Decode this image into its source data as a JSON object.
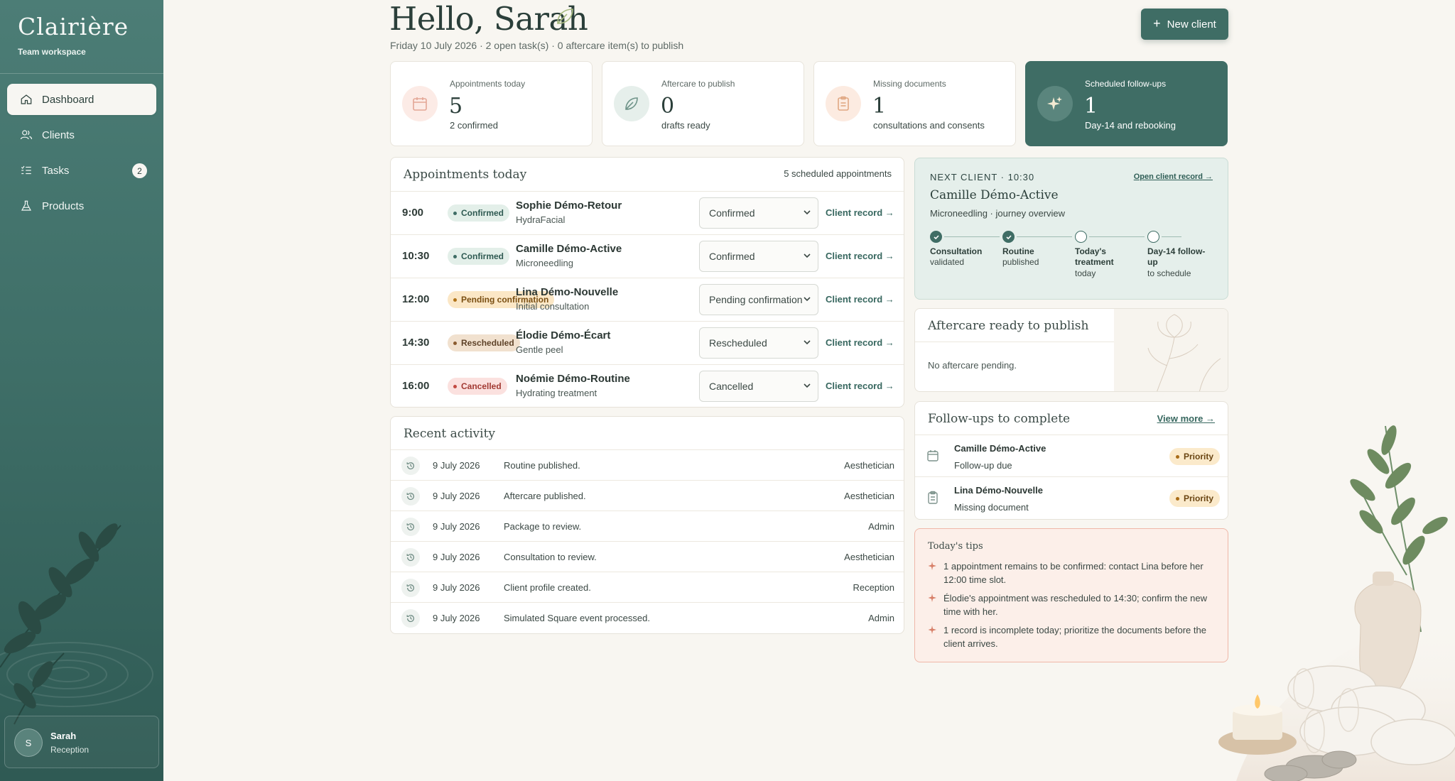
{
  "app": {
    "brand": "Clairière",
    "workspace": "Team workspace"
  },
  "sidebar": {
    "items": [
      {
        "label": "Dashboard",
        "icon": "home-icon",
        "active": true
      },
      {
        "label": "Clients",
        "icon": "users-icon"
      },
      {
        "label": "Tasks",
        "icon": "checklist-icon",
        "badge": "2"
      },
      {
        "label": "Products",
        "icon": "flask-icon"
      }
    ]
  },
  "user": {
    "initial": "S",
    "name": "Sarah",
    "role": "Reception"
  },
  "header": {
    "greeting": "Hello, Sarah",
    "subtitle": "Friday 10 July 2026 · 2 open task(s) · 0 aftercare item(s) to publish",
    "new_client_label": "New client"
  },
  "stats": [
    {
      "label": "Appointments today",
      "value": "5",
      "note": "2 confirmed",
      "icon": "calendar-icon"
    },
    {
      "label": "Aftercare to publish",
      "value": "0",
      "note": "drafts ready",
      "icon": "leaf-icon"
    },
    {
      "label": "Missing documents",
      "value": "1",
      "note": "consultations and consents",
      "icon": "clipboard-icon"
    },
    {
      "label": "Scheduled follow-ups",
      "value": "1",
      "note": "Day-14 and rebooking",
      "icon": "sparkle-icon"
    }
  ],
  "appointments": {
    "title": "Appointments today",
    "count_label": "5 scheduled appointments",
    "link_label": "Client record",
    "rows": [
      {
        "time": "9:00",
        "status": "Confirmed",
        "name": "Sophie Démo-Retour",
        "service": "HydraFacial",
        "select": "Confirmed"
      },
      {
        "time": "10:30",
        "status": "Confirmed",
        "name": "Camille Démo-Active",
        "service": "Microneedling",
        "select": "Confirmed"
      },
      {
        "time": "12:00",
        "status": "Pending confirmation",
        "name": "Lina Démo-Nouvelle",
        "service": "Initial consultation",
        "select": "Pending confirmation"
      },
      {
        "time": "14:30",
        "status": "Rescheduled",
        "name": "Élodie Démo-Écart",
        "service": "Gentle peel",
        "select": "Rescheduled"
      },
      {
        "time": "16:00",
        "status": "Cancelled",
        "name": "Noémie Démo-Routine",
        "service": "Hydrating treatment",
        "select": "Cancelled"
      }
    ]
  },
  "activity": {
    "title": "Recent activity",
    "rows": [
      {
        "date": "9 July 2026",
        "text": "Routine published.",
        "role": "Aesthetician"
      },
      {
        "date": "9 July 2026",
        "text": "Aftercare published.",
        "role": "Aesthetician"
      },
      {
        "date": "9 July 2026",
        "text": "Package to review.",
        "role": "Admin"
      },
      {
        "date": "9 July 2026",
        "text": "Consultation to review.",
        "role": "Aesthetician"
      },
      {
        "date": "9 July 2026",
        "text": "Client profile created.",
        "role": "Reception"
      },
      {
        "date": "9 July 2026",
        "text": "Simulated Square event processed.",
        "role": "Admin"
      }
    ]
  },
  "next_client": {
    "kicker": "NEXT CLIENT · 10:30",
    "open_label": "Open client record",
    "name": "Camille Démo-Active",
    "desc": "Microneedling · journey overview",
    "steps": [
      {
        "title": "Consultation",
        "sub": "validated",
        "done": true
      },
      {
        "title": "Routine",
        "sub": "published",
        "done": true
      },
      {
        "title": "Today's treatment",
        "sub": "today",
        "done": false
      },
      {
        "title": "Day-14 follow-up",
        "sub": "to schedule",
        "done": false
      }
    ]
  },
  "aftercare": {
    "title": "Aftercare ready to publish",
    "empty": "No aftercare pending."
  },
  "followups": {
    "title": "Follow-ups to complete",
    "more_label": "View more",
    "rows": [
      {
        "name": "Camille Démo-Active",
        "sub": "Follow-up due",
        "tag": "Priority",
        "icon": "calendar-icon"
      },
      {
        "name": "Lina Démo-Nouvelle",
        "sub": "Missing document",
        "tag": "Priority",
        "icon": "clipboard-icon"
      }
    ]
  },
  "tips": {
    "title": "Today's tips",
    "items": [
      "1 appointment remains to be confirmed: contact Lina before her 12:00 time slot.",
      "Élodie's appointment was rescheduled to 14:30; confirm the new time with her.",
      "1 record is incomplete today; prioritize the documents before the client arrives."
    ]
  },
  "colors": {
    "accent": "#3f6d65",
    "sidebar": "#4c7d76",
    "background": "#f8f6f1"
  }
}
